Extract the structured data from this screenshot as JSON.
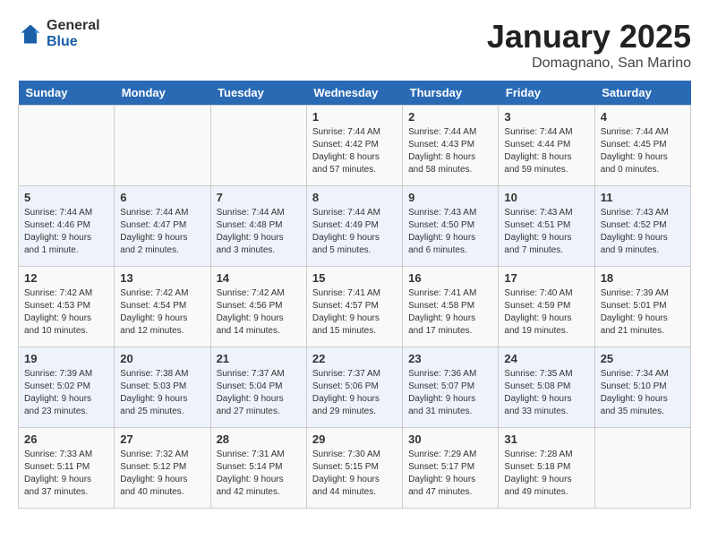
{
  "header": {
    "logo_general": "General",
    "logo_blue": "Blue",
    "title": "January 2025",
    "subtitle": "Domagnano, San Marino"
  },
  "days_of_week": [
    "Sunday",
    "Monday",
    "Tuesday",
    "Wednesday",
    "Thursday",
    "Friday",
    "Saturday"
  ],
  "weeks": [
    [
      {
        "day": null
      },
      {
        "day": null
      },
      {
        "day": null
      },
      {
        "day": "1",
        "sunrise": "7:44 AM",
        "sunset": "4:42 PM",
        "daylight": "Daylight: 8 hours and 57 minutes."
      },
      {
        "day": "2",
        "sunrise": "7:44 AM",
        "sunset": "4:43 PM",
        "daylight": "Daylight: 8 hours and 58 minutes."
      },
      {
        "day": "3",
        "sunrise": "7:44 AM",
        "sunset": "4:44 PM",
        "daylight": "Daylight: 8 hours and 59 minutes."
      },
      {
        "day": "4",
        "sunrise": "7:44 AM",
        "sunset": "4:45 PM",
        "daylight": "Daylight: 9 hours and 0 minutes."
      }
    ],
    [
      {
        "day": "5",
        "sunrise": "7:44 AM",
        "sunset": "4:46 PM",
        "daylight": "Daylight: 9 hours and 1 minute."
      },
      {
        "day": "6",
        "sunrise": "7:44 AM",
        "sunset": "4:47 PM",
        "daylight": "Daylight: 9 hours and 2 minutes."
      },
      {
        "day": "7",
        "sunrise": "7:44 AM",
        "sunset": "4:48 PM",
        "daylight": "Daylight: 9 hours and 3 minutes."
      },
      {
        "day": "8",
        "sunrise": "7:44 AM",
        "sunset": "4:49 PM",
        "daylight": "Daylight: 9 hours and 5 minutes."
      },
      {
        "day": "9",
        "sunrise": "7:43 AM",
        "sunset": "4:50 PM",
        "daylight": "Daylight: 9 hours and 6 minutes."
      },
      {
        "day": "10",
        "sunrise": "7:43 AM",
        "sunset": "4:51 PM",
        "daylight": "Daylight: 9 hours and 7 minutes."
      },
      {
        "day": "11",
        "sunrise": "7:43 AM",
        "sunset": "4:52 PM",
        "daylight": "Daylight: 9 hours and 9 minutes."
      }
    ],
    [
      {
        "day": "12",
        "sunrise": "7:42 AM",
        "sunset": "4:53 PM",
        "daylight": "Daylight: 9 hours and 10 minutes."
      },
      {
        "day": "13",
        "sunrise": "7:42 AM",
        "sunset": "4:54 PM",
        "daylight": "Daylight: 9 hours and 12 minutes."
      },
      {
        "day": "14",
        "sunrise": "7:42 AM",
        "sunset": "4:56 PM",
        "daylight": "Daylight: 9 hours and 14 minutes."
      },
      {
        "day": "15",
        "sunrise": "7:41 AM",
        "sunset": "4:57 PM",
        "daylight": "Daylight: 9 hours and 15 minutes."
      },
      {
        "day": "16",
        "sunrise": "7:41 AM",
        "sunset": "4:58 PM",
        "daylight": "Daylight: 9 hours and 17 minutes."
      },
      {
        "day": "17",
        "sunrise": "7:40 AM",
        "sunset": "4:59 PM",
        "daylight": "Daylight: 9 hours and 19 minutes."
      },
      {
        "day": "18",
        "sunrise": "7:39 AM",
        "sunset": "5:01 PM",
        "daylight": "Daylight: 9 hours and 21 minutes."
      }
    ],
    [
      {
        "day": "19",
        "sunrise": "7:39 AM",
        "sunset": "5:02 PM",
        "daylight": "Daylight: 9 hours and 23 minutes."
      },
      {
        "day": "20",
        "sunrise": "7:38 AM",
        "sunset": "5:03 PM",
        "daylight": "Daylight: 9 hours and 25 minutes."
      },
      {
        "day": "21",
        "sunrise": "7:37 AM",
        "sunset": "5:04 PM",
        "daylight": "Daylight: 9 hours and 27 minutes."
      },
      {
        "day": "22",
        "sunrise": "7:37 AM",
        "sunset": "5:06 PM",
        "daylight": "Daylight: 9 hours and 29 minutes."
      },
      {
        "day": "23",
        "sunrise": "7:36 AM",
        "sunset": "5:07 PM",
        "daylight": "Daylight: 9 hours and 31 minutes."
      },
      {
        "day": "24",
        "sunrise": "7:35 AM",
        "sunset": "5:08 PM",
        "daylight": "Daylight: 9 hours and 33 minutes."
      },
      {
        "day": "25",
        "sunrise": "7:34 AM",
        "sunset": "5:10 PM",
        "daylight": "Daylight: 9 hours and 35 minutes."
      }
    ],
    [
      {
        "day": "26",
        "sunrise": "7:33 AM",
        "sunset": "5:11 PM",
        "daylight": "Daylight: 9 hours and 37 minutes."
      },
      {
        "day": "27",
        "sunrise": "7:32 AM",
        "sunset": "5:12 PM",
        "daylight": "Daylight: 9 hours and 40 minutes."
      },
      {
        "day": "28",
        "sunrise": "7:31 AM",
        "sunset": "5:14 PM",
        "daylight": "Daylight: 9 hours and 42 minutes."
      },
      {
        "day": "29",
        "sunrise": "7:30 AM",
        "sunset": "5:15 PM",
        "daylight": "Daylight: 9 hours and 44 minutes."
      },
      {
        "day": "30",
        "sunrise": "7:29 AM",
        "sunset": "5:17 PM",
        "daylight": "Daylight: 9 hours and 47 minutes."
      },
      {
        "day": "31",
        "sunrise": "7:28 AM",
        "sunset": "5:18 PM",
        "daylight": "Daylight: 9 hours and 49 minutes."
      },
      {
        "day": null
      }
    ]
  ]
}
